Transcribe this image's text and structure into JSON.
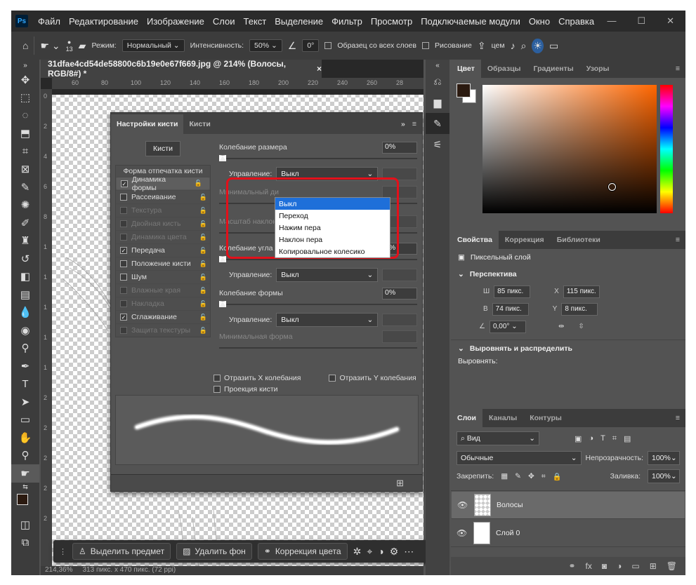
{
  "menubar": {
    "logo": "Ps",
    "items": [
      "Файл",
      "Редактирование",
      "Изображение",
      "Слои",
      "Текст",
      "Выделение",
      "Фильтр",
      "Просмотр",
      "Подключаемые модули",
      "Окно",
      "Справка"
    ]
  },
  "options": {
    "brush_size": "13",
    "mode_label": "Режим:",
    "mode_value": "Нормальный",
    "intensity_label": "Интенсивность:",
    "intensity_value": "50%",
    "angle_value": "0°",
    "sample_all_label": "Образец со всех слоев",
    "drawing_label": "Рисование",
    "extra_label": "цем"
  },
  "document": {
    "tab_title": "31dfae4cd54de58800c6b19e0e67f669.jpg @ 214% (Волосы, RGB/8#) *",
    "ruler_h": [
      "60",
      "80",
      "100",
      "120",
      "140",
      "160",
      "180",
      "200",
      "220",
      "240",
      "260",
      "28"
    ],
    "ruler_v": [
      "0",
      "2",
      "4",
      "6",
      "8",
      "1",
      "1",
      "1",
      "1",
      "1",
      "2",
      "2",
      "2",
      "2",
      "2"
    ],
    "status_zoom": "214,36%",
    "status_info": "313 пикс. x 470 пикс. (72 ppi)"
  },
  "context_bar": {
    "select_subject": "Выделить предмет",
    "remove_bg": "Удалить фон",
    "color_correction": "Коррекция цвета"
  },
  "brush_panel": {
    "tab_settings": "Настройки кисти",
    "tab_brushes": "Кисти",
    "brushes_button": "Кисти",
    "list_header": "Форма отпечатка кисти",
    "items": [
      {
        "label": "Динамика формы",
        "checked": true,
        "enabled": true,
        "selected": true
      },
      {
        "label": "Рассеивание",
        "checked": false,
        "enabled": true,
        "selected": false
      },
      {
        "label": "Текстура",
        "checked": false,
        "enabled": false,
        "selected": false
      },
      {
        "label": "Двойная кисть",
        "checked": false,
        "enabled": false,
        "selected": false
      },
      {
        "label": "Динамика цвета",
        "checked": false,
        "enabled": false,
        "selected": false
      },
      {
        "label": "Передача",
        "checked": true,
        "enabled": true,
        "selected": false
      },
      {
        "label": "Положение кисти",
        "checked": false,
        "enabled": true,
        "selected": false
      },
      {
        "label": "Шум",
        "checked": false,
        "enabled": true,
        "selected": false
      },
      {
        "label": "Влажные края",
        "checked": false,
        "enabled": false,
        "selected": false
      },
      {
        "label": "Накладка",
        "checked": false,
        "enabled": false,
        "selected": false
      },
      {
        "label": "Сглаживание",
        "checked": true,
        "enabled": true,
        "selected": false
      },
      {
        "label": "Защита текстуры",
        "checked": false,
        "enabled": false,
        "selected": false
      }
    ],
    "size_jitter_label": "Колебание размера",
    "size_jitter_value": "0%",
    "control_label": "Управление:",
    "control_value": "Выкл",
    "min_diameter_label": "Минимальный ди",
    "tilt_scale_label": "Масштаб наклон",
    "angle_jitter_label": "Колебание угла",
    "angle_jitter_value": "0%",
    "angle_control_value": "Выкл",
    "roundness_jitter_label": "Колебание формы",
    "roundness_jitter_value": "0%",
    "roundness_control_value": "Выкл",
    "min_roundness_label": "Минимальная форма",
    "flip_x_label": "Отразить X колебания",
    "flip_y_label": "Отразить Y колебания",
    "projection_label": "Проекция кисти",
    "dropdown_options": [
      "Выкл",
      "Переход",
      "Нажим пера",
      "Наклон пера",
      "Копировальное колесико"
    ]
  },
  "color_panel": {
    "tabs": [
      "Цвет",
      "Образцы",
      "Градиенты",
      "Узоры"
    ],
    "fg_color": "#2b1a10",
    "bg_color": "#ffffff"
  },
  "properties": {
    "tabs": [
      "Свойства",
      "Коррекция",
      "Библиотеки"
    ],
    "layer_type": "Пиксельный слой",
    "perspective_label": "Перспектива",
    "w_label": "Ш",
    "w_value": "85 пикс.",
    "h_label": "В",
    "h_value": "74 пикс.",
    "x_label": "X",
    "x_value": "115 пикс.",
    "y_label": "Y",
    "y_value": "8 пикс.",
    "angle_value": "0,00°",
    "align_label": "Выровнять и распределить",
    "align_sub": "Выровнять:"
  },
  "layers": {
    "tabs": [
      "Слои",
      "Каналы",
      "Контуры"
    ],
    "filter_value": "Вид",
    "blend_value": "Обычные",
    "opacity_label": "Непрозрачность:",
    "opacity_value": "100%",
    "lock_label": "Закрепить:",
    "fill_label": "Заливка:",
    "fill_value": "100%",
    "items": [
      {
        "name": "Волосы",
        "selected": true
      },
      {
        "name": "Слой 0",
        "selected": false
      }
    ]
  }
}
